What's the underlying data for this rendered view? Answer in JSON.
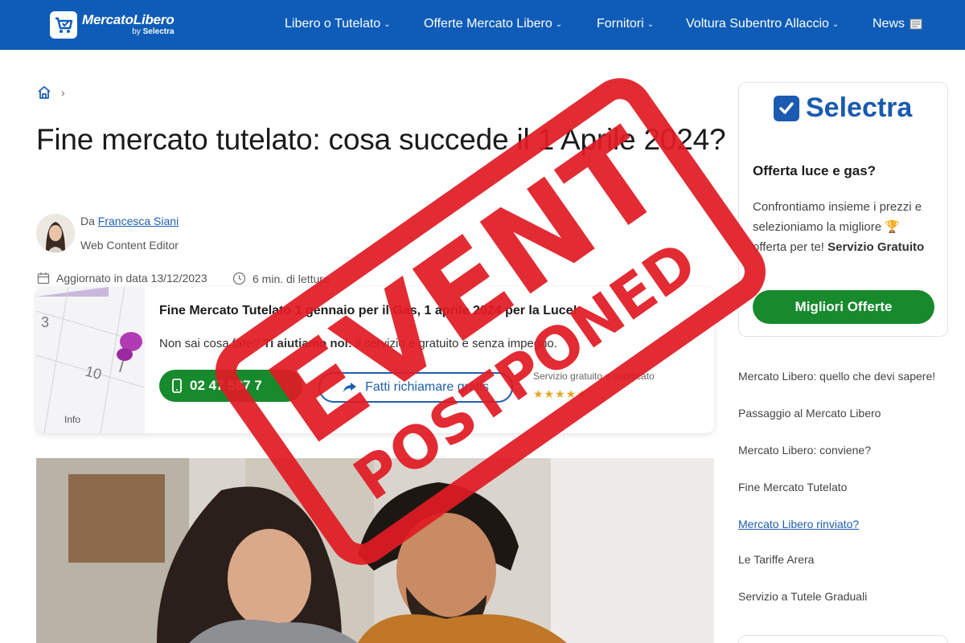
{
  "header": {
    "logo": {
      "main": "MercatoLibero",
      "by": "by",
      "sub": "Selectra"
    },
    "nav": [
      {
        "label": "Libero o Tutelato",
        "chevron": true
      },
      {
        "label": "Offerte Mercato Libero",
        "chevron": true
      },
      {
        "label": "Fornitori",
        "chevron": true
      },
      {
        "label": "Voltura Subentro Allaccio",
        "chevron": true
      },
      {
        "label": "News",
        "chevron": false
      }
    ]
  },
  "breadcrumb": {
    "separator": "›"
  },
  "article": {
    "title": "Fine mercato tutelato: cosa succede il 1 Aprile 2024?",
    "author_prefix": "Da",
    "author_name": "Francesca Siani",
    "author_role": "Web Content Editor",
    "updated": "Aggiornato in data 13/12/2023",
    "reading_time": "6 min. di lettura"
  },
  "info_card": {
    "image_label": "Info",
    "title": "Fine Mercato Tutelato 1 gennaio per il Gas, 1 aprile 2024 per la Luce!",
    "text_start": "Non sai cosa fare? ",
    "text_bold": "Ti aiutiamo noi:",
    "text_end": " il servizio è gratuito e senza impegno.",
    "phone": "02 47 587 7",
    "callback": "Fatti richiamare gratis",
    "free_service": "Servizio gratuito e certificato",
    "stars": "★★★★★"
  },
  "sidebar": {
    "brand": "Selectra",
    "offer_title": "Offerta luce e gas?",
    "offer_text": "Confrontiamo insieme i prezzi e selezioniamo la migliore 🏆 offerta per te! ",
    "offer_bold": "Servizio Gratuito",
    "offer_button": "Migliori Offerte",
    "links": [
      {
        "label": "Mercato Libero: quello che devi sapere!",
        "active": false
      },
      {
        "label": "Passaggio al Mercato Libero",
        "active": false
      },
      {
        "label": "Mercato Libero: conviene?",
        "active": false
      },
      {
        "label": "Fine Mercato Tutelato",
        "active": false
      },
      {
        "label": "Mercato Libero rinviato?",
        "active": true
      },
      {
        "label": "Le Tariffe Arera",
        "active": false
      },
      {
        "label": "Servizio a Tutele Graduali",
        "active": false
      }
    ]
  },
  "stamp": {
    "line1": "EVENT",
    "line2": "POSTPONED",
    "color": "#e01b24"
  },
  "colors": {
    "brand_blue": "#0e5cb7",
    "green": "#168a2c",
    "link": "#1f5fae"
  }
}
